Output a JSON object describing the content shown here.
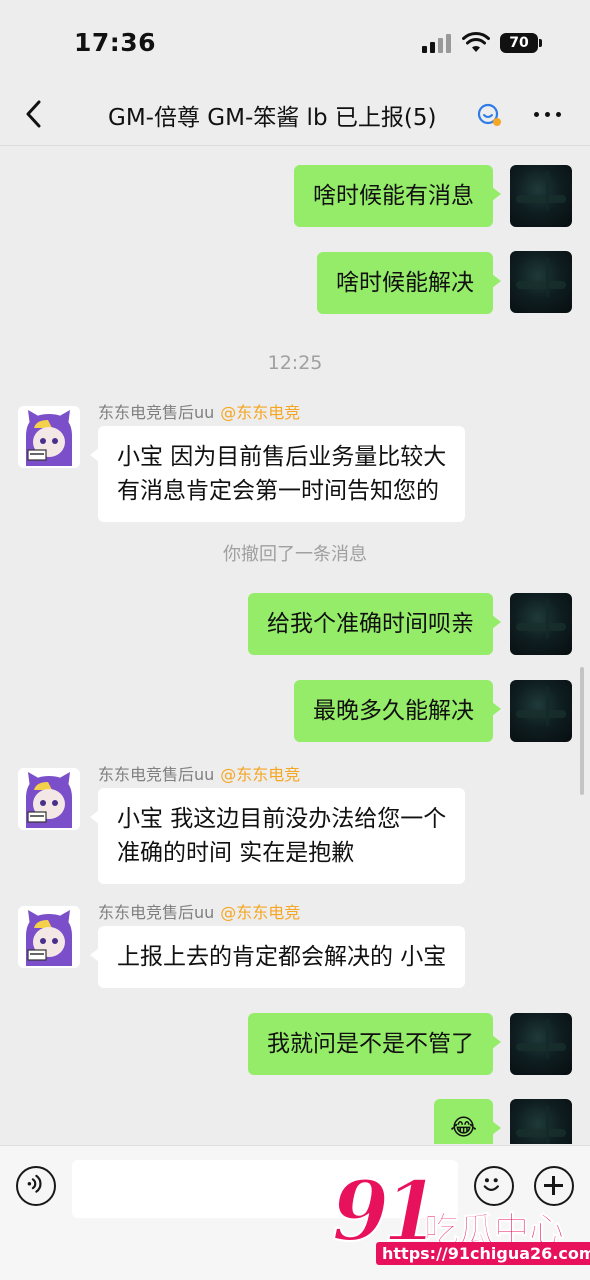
{
  "status_bar": {
    "time": "17:36",
    "battery": "70"
  },
  "header": {
    "title": "GM-倍尊 GM-笨酱 lb 已上报(5)",
    "back_icon": "chevron-left-icon",
    "more_icon": "more-dots-icon"
  },
  "messages": [
    {
      "type": "out",
      "text": "啥时候能有消息"
    },
    {
      "type": "out",
      "text": "啥时候能解决"
    },
    {
      "type": "time",
      "text": "12:25"
    },
    {
      "type": "in",
      "sender": "东东电竞售后uu",
      "tag": "@东东电竞",
      "lines": [
        "小宝 因为目前售后业务量比较大",
        "有消息肯定会第一时间告知您的"
      ]
    },
    {
      "type": "system",
      "text": "你撤回了一条消息"
    },
    {
      "type": "out",
      "text": "给我个准确时间呗亲"
    },
    {
      "type": "out",
      "text": "最晚多久能解决"
    },
    {
      "type": "in",
      "sender": "东东电竞售后uu",
      "tag": "@东东电竞",
      "lines": [
        "小宝 我这边目前没办法给您一个",
        "准确的时间 实在是抱歉"
      ]
    },
    {
      "type": "in",
      "sender": "东东电竞售后uu",
      "tag": "@东东电竞",
      "lines": [
        "上报上去的肯定都会解决的 小宝"
      ]
    },
    {
      "type": "out",
      "text": "我就问是不是不管了"
    },
    {
      "type": "out",
      "text": "😂"
    }
  ],
  "input_bar": {
    "voice_icon": "voice-icon",
    "emoji_icon": "emoji-icon",
    "plus_icon": "plus-icon",
    "text_value": ""
  },
  "watermark": {
    "number": "91",
    "text": "吃瓜中心",
    "url": "https://91chigua26.com"
  },
  "colors": {
    "outgoing_bubble": "#95ec69",
    "incoming_bubble": "#ffffff",
    "background": "#ededed",
    "tag": "#f5a623",
    "watermark": "#e8125c"
  }
}
